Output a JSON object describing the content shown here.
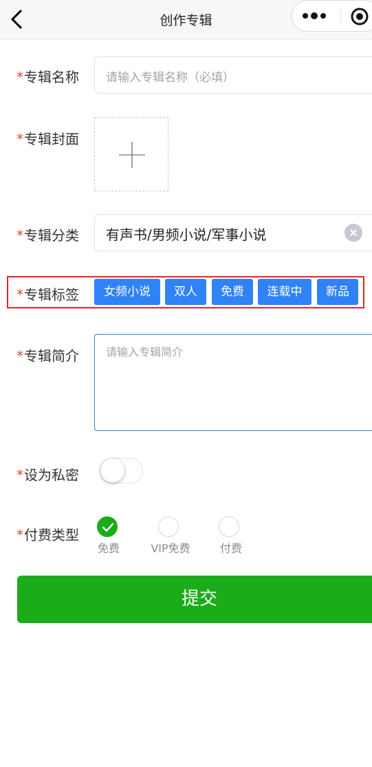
{
  "navbar": {
    "title": "创作专辑"
  },
  "form": {
    "required_mark": "*",
    "name": {
      "label": "专辑名称",
      "placeholder": "请输入专辑名称（必填）"
    },
    "cover": {
      "label": "专辑封面"
    },
    "category": {
      "label": "专辑分类",
      "value": "有声书/男频小说/军事小说"
    },
    "tags": {
      "label": "专辑标签",
      "items": [
        "女频小说",
        "双人",
        "免费",
        "连载中",
        "新品"
      ],
      "tag_color": "#2f83f7",
      "highlight_color": "#e3232a"
    },
    "intro": {
      "label": "专辑简介",
      "placeholder": "请输入专辑简介"
    },
    "private": {
      "label": "设为私密",
      "enabled": false
    },
    "pay_type": {
      "label": "付费类型",
      "options": [
        "免费",
        "VIP免费",
        "付费"
      ],
      "selected_index": 0,
      "accent_color": "#1aad19"
    }
  },
  "submit": {
    "label": "提交",
    "color": "#1aad19"
  }
}
